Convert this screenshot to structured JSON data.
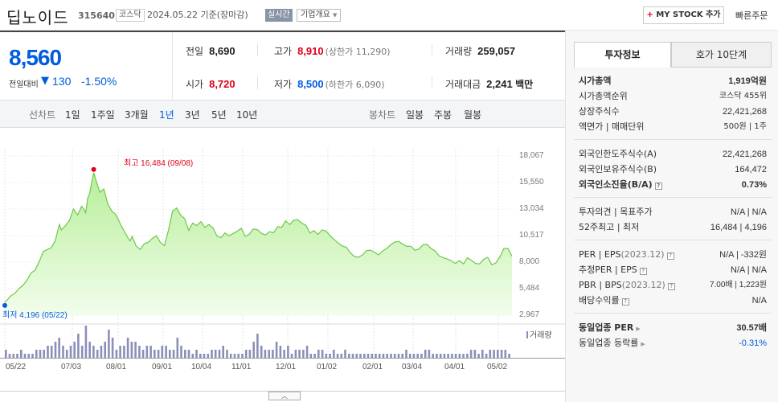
{
  "header": {
    "company_name": "딥노이드",
    "code": "315640",
    "market": "코스닥",
    "date": "2024.05.22 기준(장마감)",
    "realtime": "실시간",
    "company_info": "기업개요",
    "my_stock": "MY STOCK 추가",
    "quick_order": "빠른주문"
  },
  "summary": {
    "price": "8,560",
    "change_label": "전일대비",
    "change_arrow": "▼",
    "change_value": "130",
    "change_pct": "-1.50%",
    "prev_close_label": "전일",
    "prev_close": "8,690",
    "high_label": "고가",
    "high": "8,910",
    "upper_limit": "(상한가 11,290)",
    "volume_label": "거래량",
    "volume": "259,057",
    "open_label": "시가",
    "open": "8,720",
    "low_label": "저가",
    "low": "8,500",
    "lower_limit": "(하한가 6,090)",
    "amount_label": "거래대금",
    "amount": "2,241",
    "amount_unit": "백만"
  },
  "period_tabs": {
    "line_label": "선차트",
    "line_items": [
      "1일",
      "1주일",
      "3개월",
      "1년",
      "3년",
      "5년",
      "10년"
    ],
    "active": "1년",
    "candle_label": "봉차트",
    "candle_items": [
      "일봉",
      "주봉",
      "월봉"
    ]
  },
  "chart_data": {
    "type": "area",
    "title": "",
    "x_ticks": [
      "05/22",
      "07/03",
      "08/01",
      "09/01",
      "10/04",
      "11/01",
      "12/01",
      "01/02",
      "02/01",
      "03/04",
      "04/01",
      "05/02"
    ],
    "y_ticks": [
      "18,067",
      "15,550",
      "13,034",
      "10,517",
      "8,000",
      "5,484",
      "2,967"
    ],
    "ylim": [
      2967,
      18067
    ],
    "series": [
      {
        "x": [
          0,
          1,
          3,
          5,
          7,
          9,
          11,
          13,
          15,
          17,
          19,
          21,
          23,
          25,
          27,
          28,
          30,
          32,
          34,
          36,
          37,
          38,
          39,
          40,
          41,
          42,
          43,
          44,
          45,
          47,
          49,
          51,
          53,
          55,
          57,
          59,
          61,
          62,
          63,
          65,
          67,
          69,
          71,
          73,
          75,
          77,
          79,
          81,
          83,
          85,
          87,
          89,
          91,
          93,
          95,
          97,
          99,
          101,
          103,
          105,
          107,
          109,
          111,
          113,
          115,
          117,
          119,
          121,
          123,
          125,
          127,
          129,
          131,
          133,
          135,
          137,
          139,
          141,
          143,
          145,
          147,
          149,
          151,
          153,
          155,
          157,
          159,
          161,
          163,
          165,
          167,
          169,
          171,
          173,
          175,
          177,
          179,
          181,
          183,
          185,
          187,
          189,
          191,
          193,
          195,
          197,
          199,
          201,
          203,
          205,
          207,
          209,
          211,
          213,
          215,
          217,
          219,
          221,
          223,
          225,
          227,
          229,
          231,
          233,
          235,
          237,
          239,
          241,
          243,
          245,
          247,
          249,
          251
        ],
        "values": [
          4196,
          4380,
          4800,
          5050,
          5480,
          5800,
          6300,
          6980,
          7250,
          8020,
          9010,
          9190,
          9360,
          10050,
          11580,
          11050,
          11460,
          11950,
          13040,
          12480,
          12860,
          13290,
          13070,
          12680,
          14060,
          14520,
          15550,
          16484,
          15850,
          14630,
          14940,
          13500,
          12830,
          12500,
          11690,
          10970,
          10270,
          10010,
          10440,
          9530,
          9190,
          9730,
          9890,
          10240,
          10500,
          9850,
          9560,
          11020,
          12830,
          13130,
          12470,
          12130,
          11020,
          11700,
          11460,
          11840,
          11290,
          11560,
          11250,
          10460,
          10320,
          10770,
          10490,
          10720,
          10930,
          11210,
          10440,
          10650,
          11140,
          11070,
          10730,
          10580,
          10890,
          10790,
          11370,
          11290,
          11910,
          11560,
          11980,
          12020,
          11700,
          11490,
          10750,
          10990,
          10630,
          11050,
          10960,
          10500,
          10150,
          9800,
          9530,
          9410,
          8890,
          8540,
          8460,
          8690,
          9090,
          9140,
          8920,
          8690,
          9060,
          9300,
          9650,
          9900,
          9970,
          9700,
          9490,
          9510,
          9120,
          9240,
          9640,
          9680,
          9290,
          9050,
          8580,
          8420,
          8290,
          8120,
          7870,
          8130,
          7830,
          8410,
          8150,
          7880,
          7830,
          8270,
          8460,
          7740,
          7920,
          8480,
          9280,
          9300,
          8560
        ],
        "name": ""
      }
    ],
    "high_marker": "최고 16,484 (09/08)",
    "low_marker": "최저 4,196 (05/22)",
    "volume_label": "거래량",
    "volume": [
      2,
      1,
      1,
      1,
      2,
      1,
      1,
      1,
      2,
      2,
      2,
      3,
      3,
      4,
      5,
      3,
      2,
      3,
      4,
      6,
      3,
      8,
      4,
      3,
      2,
      3,
      4,
      7,
      5,
      2,
      3,
      3,
      5,
      4,
      4,
      3,
      2,
      3,
      3,
      2,
      2,
      3,
      3,
      2,
      2,
      5,
      3,
      2,
      2,
      1,
      2,
      1,
      1,
      1,
      2,
      2,
      2,
      3,
      2,
      1,
      1,
      1,
      1,
      2,
      2,
      4,
      6,
      3,
      2,
      2,
      2,
      4,
      3,
      2,
      3,
      1,
      2,
      2,
      2,
      3,
      1,
      1,
      2,
      2,
      1,
      1,
      2,
      1,
      1,
      2,
      1,
      1,
      1,
      1,
      1,
      1,
      1,
      1,
      1,
      1,
      1,
      1,
      1,
      1,
      1,
      2,
      1,
      1,
      1,
      1,
      2,
      2,
      1,
      1,
      1,
      1,
      1,
      1,
      1,
      1,
      1,
      1,
      2,
      2,
      1,
      2,
      1,
      2,
      2,
      2,
      2,
      2,
      1
    ]
  },
  "right_panel": {
    "tabs": [
      "투자정보",
      "호가 10단계"
    ],
    "rows1": [
      {
        "k": "시가총액",
        "v": "1,919억원",
        "bold": true
      },
      {
        "k": "시가총액순위",
        "v": "코스닥 455위"
      },
      {
        "k": "상장주식수",
        "v": "22,421,268"
      },
      {
        "k": "액면가 | 매매단위",
        "v": "500원 | 1주"
      }
    ],
    "rows2": [
      {
        "k": "외국인한도주식수(A)",
        "v": "22,421,268"
      },
      {
        "k": "외국인보유주식수(B)",
        "v": "164,472"
      },
      {
        "k": "외국인소진율(B/A)",
        "v": "0.73%",
        "bold": true
      }
    ],
    "opinion_label": "투자의견 | 목표주가",
    "opinion_value": "N/A | N/A",
    "week52_label": "52주최고 | 최저",
    "week52_value": "16,484 | 4,196",
    "per_label": "PER | EPS",
    "per_year": "(2023.12)",
    "per_value": "N/A | -332원",
    "est_label": "추정PER | EPS",
    "est_value": "N/A | N/A",
    "pbr_label": "PBR | BPS",
    "pbr_year": "(2023.12)",
    "pbr_value": "7.00배 | 1,223원",
    "div_label": "배당수익률",
    "div_value": "N/A",
    "sector_per_label": "동일업종 PER",
    "sector_per_value": "30.57배",
    "sector_chg_label": "동일업종 등락률",
    "sector_chg_value": "-0.31%"
  }
}
